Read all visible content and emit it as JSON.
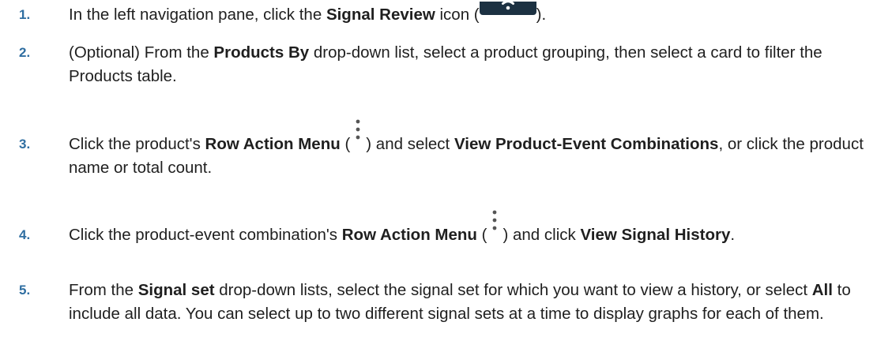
{
  "steps": [
    {
      "number": "1.",
      "pre": "In the left navigation pane, click the ",
      "bold": "Signal Review",
      "post1": " icon (",
      "icon": "signal-review-icon",
      "post2": ")."
    },
    {
      "number": "2.",
      "pre": "(Optional) From the ",
      "bold": "Products By",
      "post": " drop-down list, select a product grouping, then select a card to filter the Products table."
    },
    {
      "number": "3.",
      "pre": "Click the product's ",
      "bold1": "Row Action Menu",
      "mid1": " (",
      "icon": "kebab-menu-icon",
      "mid2": ") and select ",
      "bold2": "View Product-Event Combinations",
      "post": ", or click the product name or total count."
    },
    {
      "number": "4.",
      "pre": "Click the product-event combination's ",
      "bold1": "Row Action Menu",
      "mid1": " (",
      "icon": "kebab-menu-icon",
      "mid2": ") and click ",
      "bold2": "View Signal History",
      "post": "."
    },
    {
      "number": "5.",
      "pre": "From the ",
      "bold1": "Signal set",
      "mid": " drop-down lists, select the signal set for which you want to view a history, or select ",
      "bold2": "All",
      "post": " to include all data. You can select up to two different signal sets at a time to display graphs for each of them."
    }
  ],
  "colors": {
    "step_number": "#2f6ea1",
    "icon_background": "#1c3142",
    "icon_foreground": "#ffffff"
  }
}
